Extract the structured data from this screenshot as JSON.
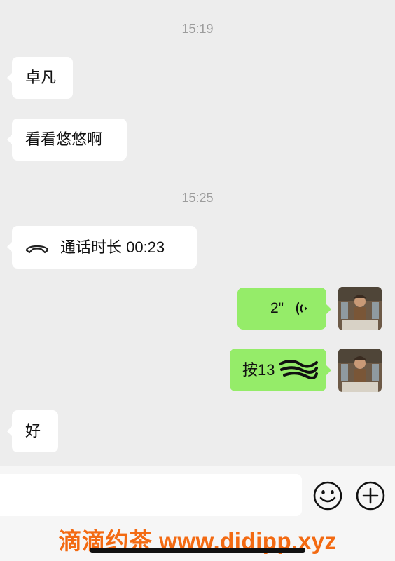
{
  "chat": {
    "time_1": "15:19",
    "msg_1": "卓凡",
    "msg_2": "看看悠悠啊",
    "time_2": "15:25",
    "call": {
      "icon": "phone-hangup-icon",
      "label": "通话时长 00:23"
    },
    "voice": {
      "duration": "2\"",
      "icon": "voice-wave-icon"
    },
    "msg_redacted": "按13",
    "msg_last": "好"
  },
  "colors": {
    "background": "#ededed",
    "bubble_left": "#ffffff",
    "bubble_right": "#95ec69",
    "timestamp": "#9c9c9c",
    "watermark": "#f36a12"
  },
  "input_bar": {
    "emoji_icon": "emoji-icon",
    "plus_icon": "plus-icon"
  },
  "watermark": "滴滴约茶 www.didipp.xyz"
}
